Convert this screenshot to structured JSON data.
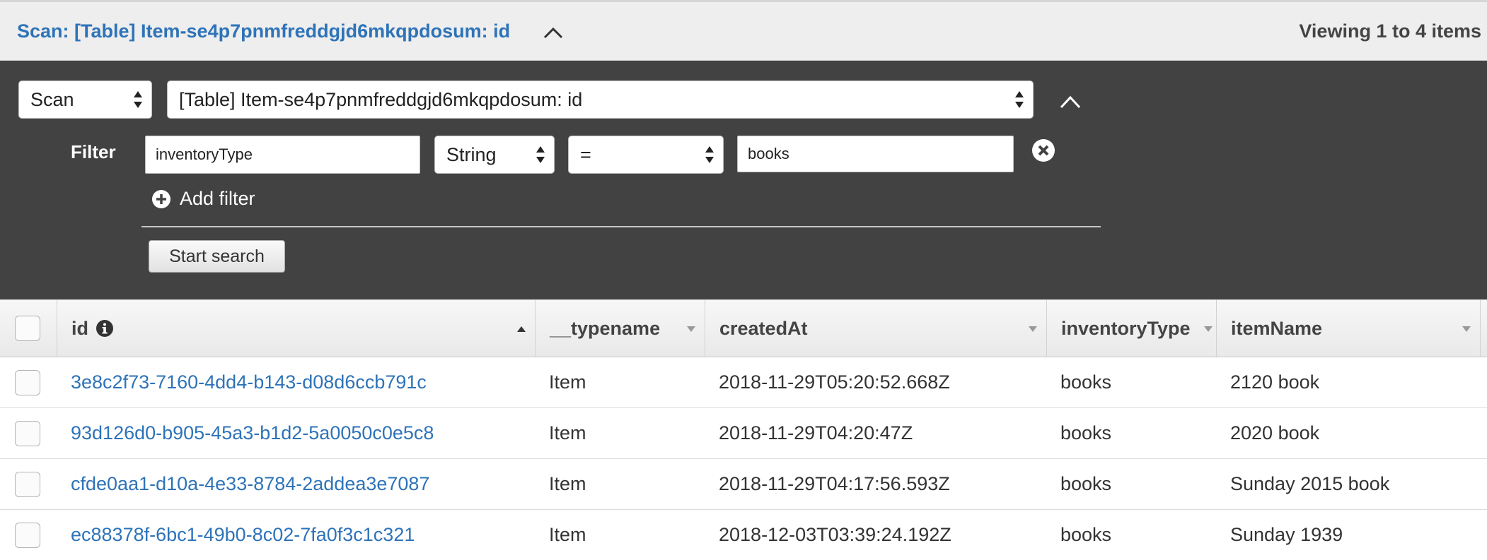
{
  "header": {
    "title": "Scan: [Table] Item-se4p7pnmfreddgjd6mkqpdosum: id",
    "viewing": "Viewing 1 to 4 items"
  },
  "query": {
    "operation": "Scan",
    "target": "[Table] Item-se4p7pnmfreddgjd6mkqpdosum: id",
    "filter_label": "Filter",
    "filter": {
      "attribute": "inventoryType",
      "type": "String",
      "operator": "=",
      "value": "books"
    },
    "add_filter_label": "Add filter",
    "start_search_label": "Start search"
  },
  "table": {
    "columns": [
      "id",
      "__typename",
      "createdAt",
      "inventoryType",
      "itemName"
    ],
    "rows": [
      {
        "id": "3e8c2f73-7160-4dd4-b143-d08d6ccb791c",
        "typename": "Item",
        "createdAt": "2018-11-29T05:20:52.668Z",
        "inventoryType": "books",
        "itemName": "2120 book"
      },
      {
        "id": "93d126d0-b905-45a3-b1d2-5a0050c0e5c8",
        "typename": "Item",
        "createdAt": "2018-11-29T04:20:47Z",
        "inventoryType": "books",
        "itemName": "2020 book"
      },
      {
        "id": "cfde0aa1-d10a-4e33-8784-2addea3e7087",
        "typename": "Item",
        "createdAt": "2018-11-29T04:17:56.593Z",
        "inventoryType": "books",
        "itemName": "Sunday 2015 book"
      },
      {
        "id": "ec88378f-6bc1-49b0-8c02-7fa0f3c1c321",
        "typename": "Item",
        "createdAt": "2018-12-03T03:39:24.192Z",
        "inventoryType": "books",
        "itemName": "Sunday 1939"
      }
    ]
  },
  "colors": {
    "link": "#2e73b8",
    "panel_bg": "#424242",
    "header_bg": "#eeeeee"
  },
  "icons": {
    "collapse": "chevron-up-icon",
    "clear_filter": "close-circle-icon",
    "add_filter": "plus-circle-icon",
    "id_info": "info-icon",
    "sort": "caret-icon"
  }
}
